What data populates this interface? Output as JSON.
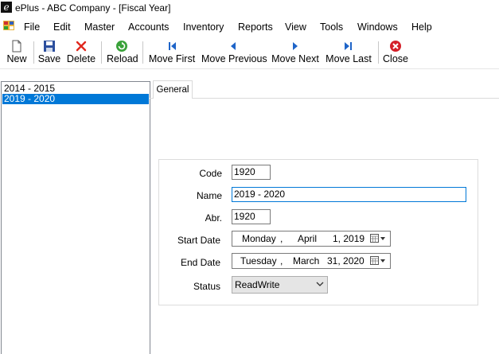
{
  "window": {
    "title": "ePlus - ABC Company - [Fiscal Year]",
    "app_icon_glyph": "e"
  },
  "menu": {
    "items": [
      "File",
      "Edit",
      "Master",
      "Accounts",
      "Inventory",
      "Reports",
      "View",
      "Tools",
      "Windows",
      "Help"
    ]
  },
  "toolbar": {
    "new": "New",
    "save": "Save",
    "delete": "Delete",
    "reload": "Reload",
    "move_first": "Move First",
    "move_previous": "Move Previous",
    "move_next": "Move Next",
    "move_last": "Move Last",
    "close": "Close"
  },
  "list": {
    "items": [
      "2014 - 2015",
      "2019 -  2020"
    ],
    "selected_index": 1
  },
  "tabs": {
    "general": "General"
  },
  "form": {
    "code_label": "Code",
    "code_value": "1920",
    "name_label": "Name",
    "name_value": "2019 -  2020",
    "abr_label": "Abr.",
    "abr_value": "1920",
    "start_label": "Start Date",
    "start_day": "Monday",
    "start_sep": ",",
    "start_month": "April",
    "start_date": "1, 2019",
    "end_label": "End Date",
    "end_day": "Tuesday",
    "end_sep": ",",
    "end_month": "March",
    "end_date": "31, 2020",
    "status_label": "Status",
    "status_value": "ReadWrite"
  },
  "colors": {
    "selection": "#0078d7",
    "focus_border": "#0078d7",
    "delete_red": "#e0281e",
    "nav_blue": "#1e64c8",
    "reload_green": "#3aa23a"
  }
}
